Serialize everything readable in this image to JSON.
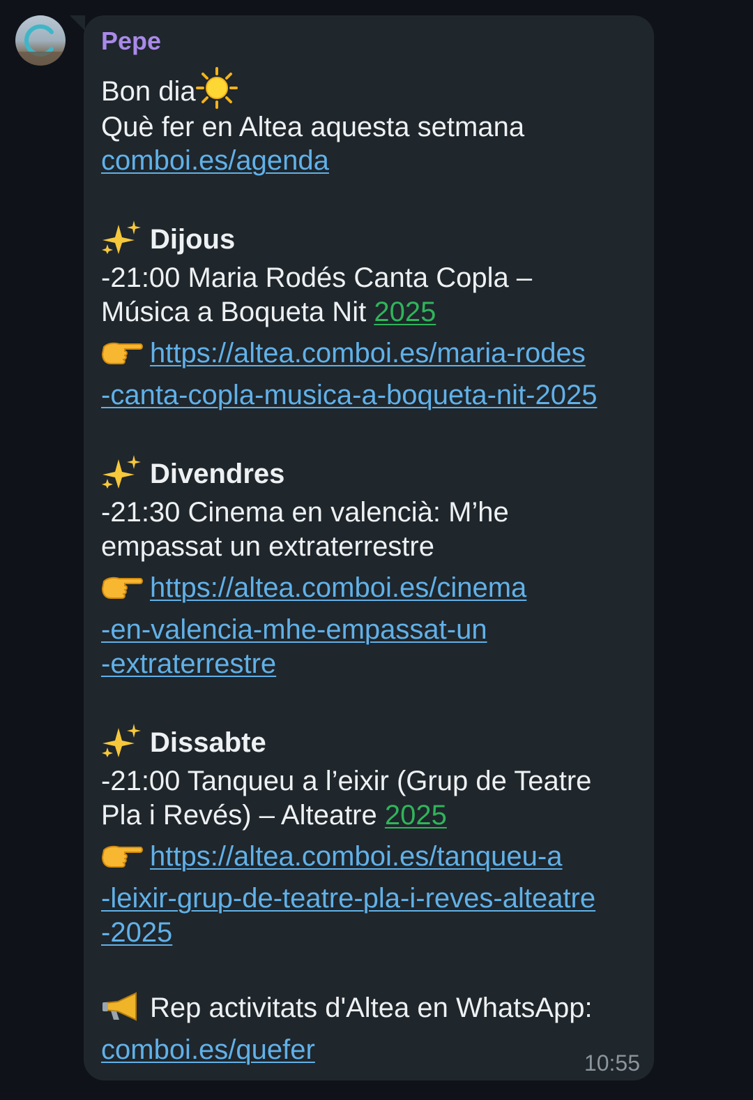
{
  "message": {
    "sender": "Pepe",
    "greeting": "Bon dia",
    "intro": "Què fer en Altea aquesta setmana",
    "agenda_link": "comboi.es/agenda",
    "days": [
      {
        "day": "Dijous",
        "event_line1": "-21:00 Maria Rodés Canta Copla –",
        "event_line2": "Música a Boqueta Nit",
        "event_year": "2025",
        "link_line1": "https://altea.comboi.es/maria-rodes",
        "link_line2": "-canta-copla-musica-a-boqueta-nit-2025"
      },
      {
        "day": "Divendres",
        "event_line1": "-21:30 Cinema en valencià: M’he",
        "event_line2": "empassat un extraterrestre",
        "link_line1": "https://altea.comboi.es/cinema",
        "link_line2": "-en-valencia-mhe-empassat-un",
        "link_line3": "-extraterrestre"
      },
      {
        "day": "Dissabte",
        "event_line1": "-21:00 Tanqueu a l’eixir (Grup de Teatre",
        "event_line2": "Pla i Revés) – Alteatre",
        "event_year": "2025",
        "link_line1": "https://altea.comboi.es/tanqueu-a",
        "link_line2": "-leixir-grup-de-teatre-pla-i-reves-alteatre",
        "link_line3": "-2025"
      }
    ],
    "whatsapp_text": "Rep activitats d'Altea en WhatsApp:",
    "whatsapp_link": "comboi.es/quefer",
    "time": "10:55"
  },
  "icons": {
    "avatar": "avatar",
    "sun": "sun-emoji-icon",
    "sparkles": "sparkles-emoji-icon",
    "pointing": "pointing-right-emoji-icon",
    "megaphone": "megaphone-emoji-icon"
  },
  "colors": {
    "background": "#0f1319",
    "bubble": "#1f262c",
    "sender": "#a98ae8",
    "link": "#61b1e8",
    "year": "#2fb55a",
    "text": "#eef1f3",
    "time": "#8c959c"
  }
}
